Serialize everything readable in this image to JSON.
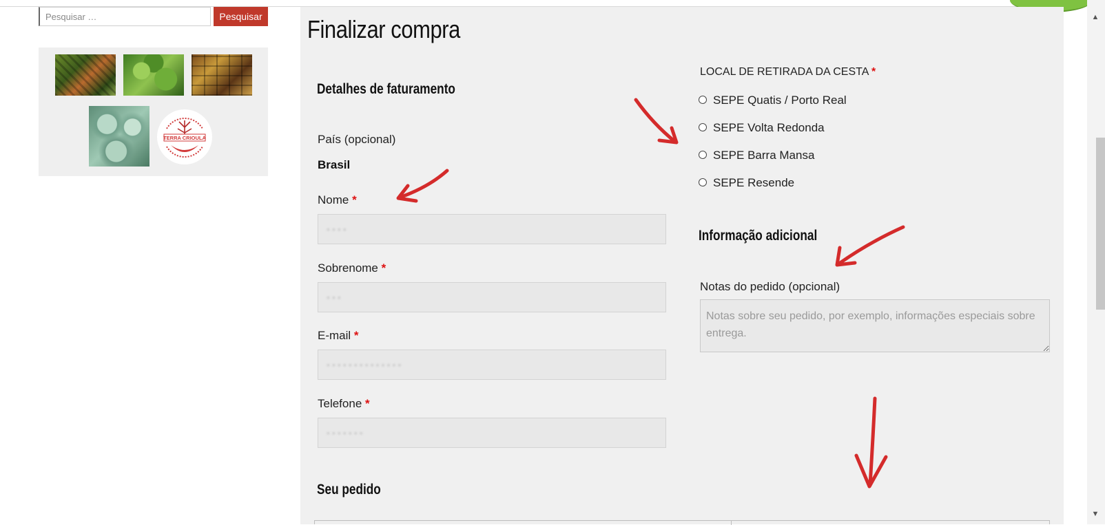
{
  "sidebar": {
    "search_placeholder": "Pesquisar …",
    "search_button": "Pesquisar",
    "logo_text": "TERRA CRIOULA"
  },
  "checkout": {
    "title": "Finalizar compra",
    "billing_heading": "Detalhes de faturamento",
    "country_label": "País (opcional)",
    "country_value": "Brasil",
    "fields": [
      {
        "label": "Nome",
        "required": "*"
      },
      {
        "label": "Sobrenome",
        "required": "*"
      },
      {
        "label": "E-mail",
        "required": "*"
      },
      {
        "label": "Telefone",
        "required": "*"
      }
    ],
    "pickup": {
      "label": "LOCAL DE RETIRADA DA CESTA",
      "required": "*",
      "options": [
        "SEPE Quatis / Porto Real",
        "SEPE Volta Redonda",
        "SEPE Barra Mansa",
        "SEPE Resende"
      ]
    },
    "additional_heading": "Informação adicional",
    "notes_label": "Notas do pedido (opcional)",
    "notes_placeholder": "Notas sobre seu pedido, por exemplo, informações especiais sobre entrega.",
    "order_heading": "Seu pedido"
  },
  "colors": {
    "accent": "#c0392b",
    "required": "#dd1111",
    "annotation_arrow": "#d42b2b",
    "panel_bg": "#f0f0f0"
  }
}
